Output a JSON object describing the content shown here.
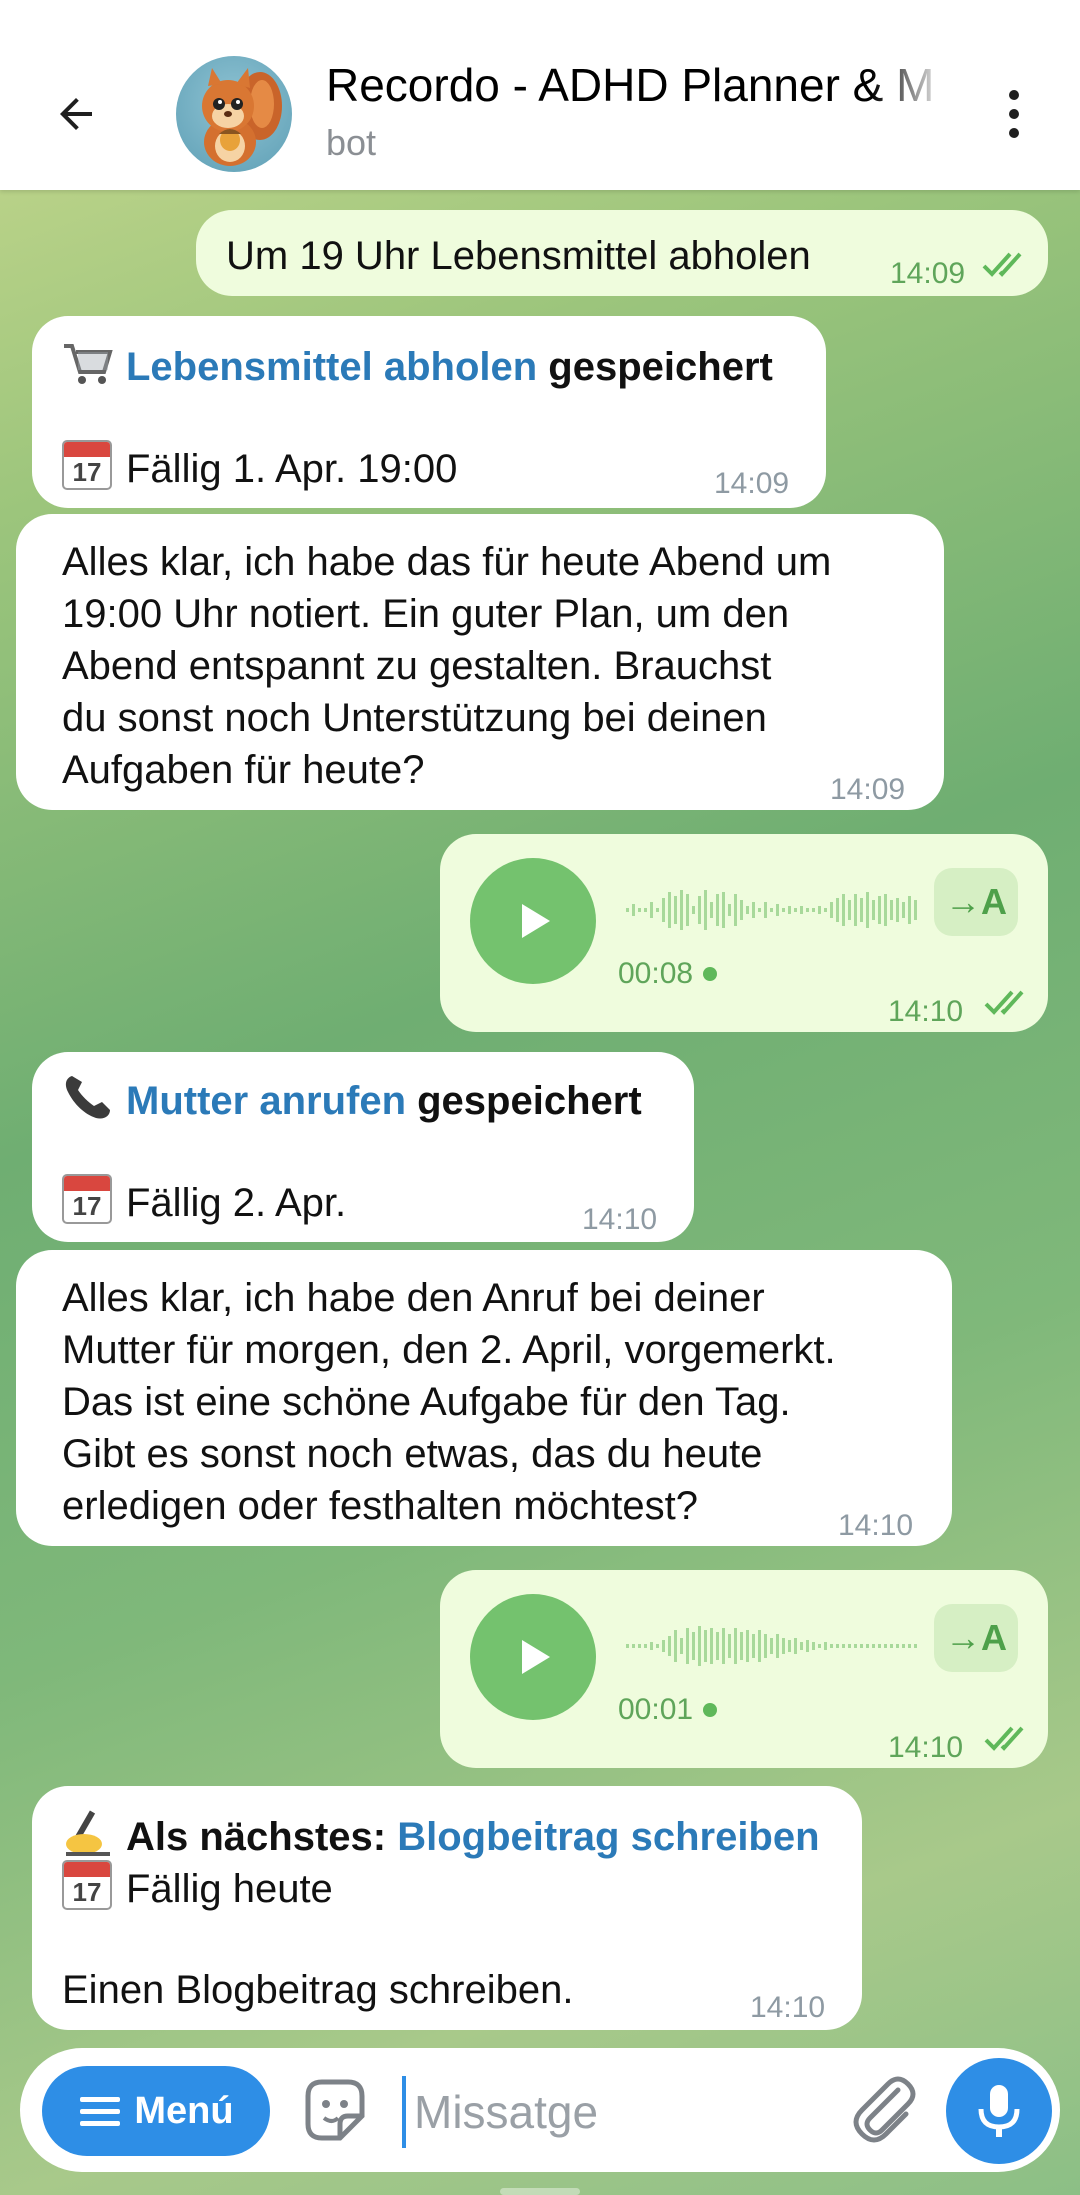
{
  "header": {
    "title": "Recordo - ADHD Planner & M",
    "subtitle": "bot"
  },
  "messages": [
    {
      "type": "out_text",
      "text": "Um 19 Uhr Lebensmittel abholen",
      "time": "14:09"
    },
    {
      "type": "in_card",
      "icon": "shopping-cart-icon",
      "task": "Lebensmittel abholen",
      "status": "gespeichert",
      "calendar_day": "17",
      "due": "Fällig 1. Apr. 19:00",
      "time": "14:09"
    },
    {
      "type": "in_text",
      "lines": [
        "Alles klar, ich habe das für heute Abend um",
        "19:00 Uhr notiert. Ein guter Plan, um den",
        "Abend entspannt zu gestalten. Brauchst",
        "du sonst noch Unterstützung bei deinen",
        "Aufgaben für heute?"
      ],
      "time": "14:09"
    },
    {
      "type": "out_voice",
      "duration": "00:08",
      "transcribe": "→A",
      "time": "14:10"
    },
    {
      "type": "in_card",
      "icon": "telephone-icon",
      "task": "Mutter anrufen",
      "status": "gespeichert",
      "calendar_day": "17",
      "due": "Fällig 2. Apr.",
      "time": "14:10"
    },
    {
      "type": "in_text",
      "lines": [
        "Alles klar, ich habe den Anruf bei deiner",
        "Mutter für morgen, den 2. April, vorgemerkt.",
        "Das ist eine schöne Aufgabe für den Tag.",
        "Gibt es sonst noch etwas, das du heute",
        "erledigen oder festhalten möchtest?"
      ],
      "time": "14:10"
    },
    {
      "type": "out_voice",
      "duration": "00:01",
      "transcribe": "→A",
      "time": "14:10"
    },
    {
      "type": "in_next",
      "icon": "writing-hand-icon",
      "prefix": "Als nächstes:",
      "task": "Blogbeitrag schreiben",
      "calendar_day": "17",
      "due": "Fällig heute",
      "description": "Einen Blogbeitrag schreiben.",
      "time": "14:10"
    }
  ],
  "input": {
    "menu_label": "Menú",
    "placeholder": "Missatge"
  },
  "colors": {
    "link": "#2b7ab8",
    "accent": "#2e8ee6",
    "outgoing_bubble": "#effcdd",
    "incoming_bubble": "#ffffff",
    "voice_green": "#74c26e"
  }
}
